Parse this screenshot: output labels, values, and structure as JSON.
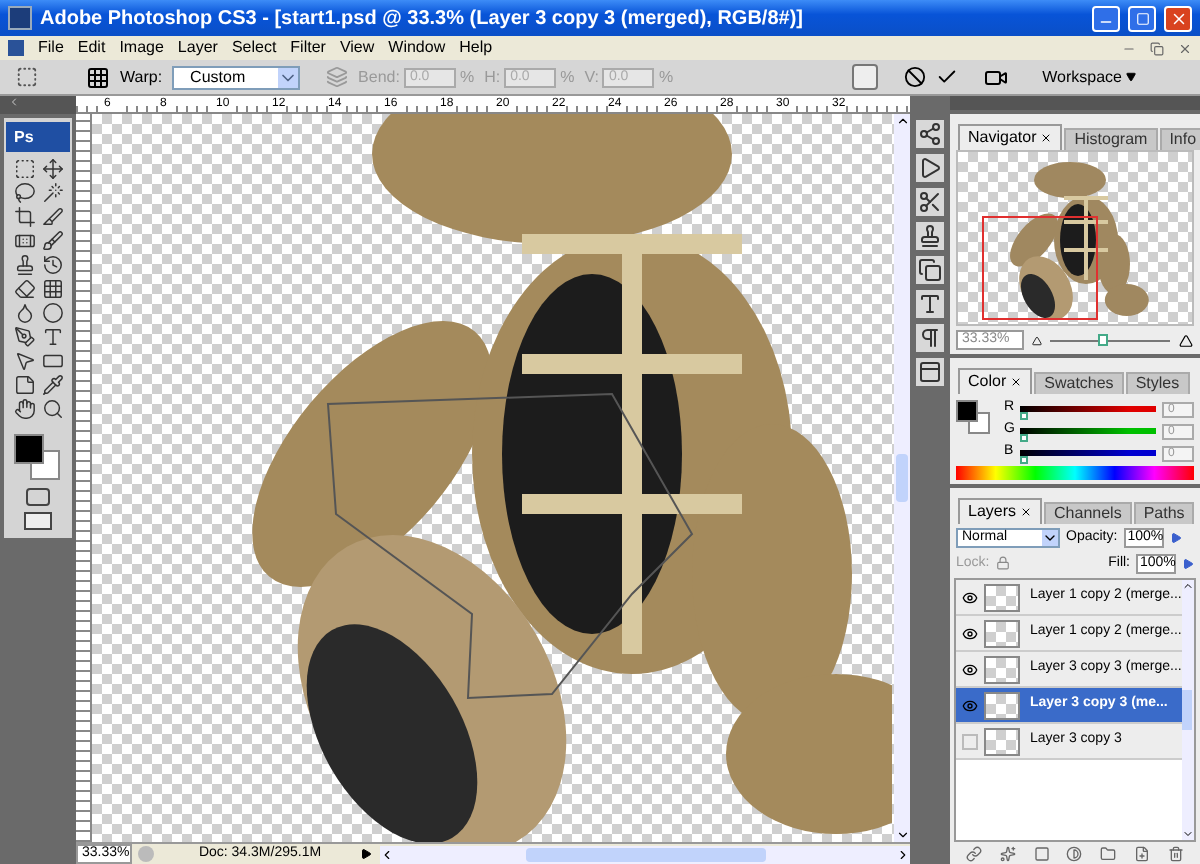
{
  "window": {
    "title": "Adobe Photoshop CS3 - [start1.psd @ 33.3% (Layer 3 copy 3 (merged), RGB/8#)]"
  },
  "menu": [
    "File",
    "Edit",
    "Image",
    "Layer",
    "Select",
    "Filter",
    "View",
    "Window",
    "Help"
  ],
  "options_bar": {
    "warp_label": "Warp:",
    "warp_value": "Custom",
    "fields": [
      {
        "label": "Bend:",
        "value": "0.0",
        "unit": "%"
      },
      {
        "label": "H:",
        "value": "0.0",
        "unit": "%"
      },
      {
        "label": "V:",
        "value": "0.0",
        "unit": "%"
      }
    ],
    "workspace": "Workspace"
  },
  "ruler": [
    "6",
    "8",
    "10",
    "12",
    "14",
    "16",
    "18",
    "20",
    "22",
    "24",
    "26",
    "28",
    "30",
    "32"
  ],
  "toolbox": {
    "logo": "Ps"
  },
  "status_bar": {
    "zoom": "33.33%",
    "doc": "Doc: 34.3M/295.1M"
  },
  "navigator": {
    "tabs": [
      {
        "label": "Navigator",
        "selected": true
      },
      {
        "label": "Histogram",
        "selected": false
      },
      {
        "label": "Info",
        "selected": false
      }
    ],
    "zoom": "33.33%",
    "level": 0.45
  },
  "color": {
    "tabs": [
      {
        "label": "Color",
        "selected": true
      },
      {
        "label": "Swatches",
        "selected": false
      },
      {
        "label": "Styles",
        "selected": false
      }
    ],
    "channels": [
      {
        "name": "R",
        "value": "0",
        "level": 0,
        "color": "#e00000"
      },
      {
        "name": "G",
        "value": "0",
        "level": 0,
        "color": "#00c000"
      },
      {
        "name": "B",
        "value": "0",
        "level": 0,
        "color": "#0000d0"
      }
    ]
  },
  "layers": {
    "tabs": [
      {
        "label": "Layers",
        "selected": true
      },
      {
        "label": "Channels",
        "selected": false
      },
      {
        "label": "Paths",
        "selected": false
      }
    ],
    "blend_mode": "Normal",
    "opacity_label": "Opacity:",
    "opacity": "100%",
    "lock_label": "Lock:",
    "fill_label": "Fill:",
    "fill": "100%",
    "items": [
      {
        "name": "Layer 1 copy 2 (merge...",
        "visible": true,
        "selected": false
      },
      {
        "name": "Layer 1 copy 2 (merge...",
        "visible": true,
        "selected": false
      },
      {
        "name": "Layer 3 copy 3 (merge...",
        "visible": true,
        "selected": false
      },
      {
        "name": "Layer 3 copy 3 (me...",
        "visible": true,
        "selected": true
      },
      {
        "name": "Layer 3 copy 3",
        "visible": false,
        "selected": false
      }
    ]
  }
}
